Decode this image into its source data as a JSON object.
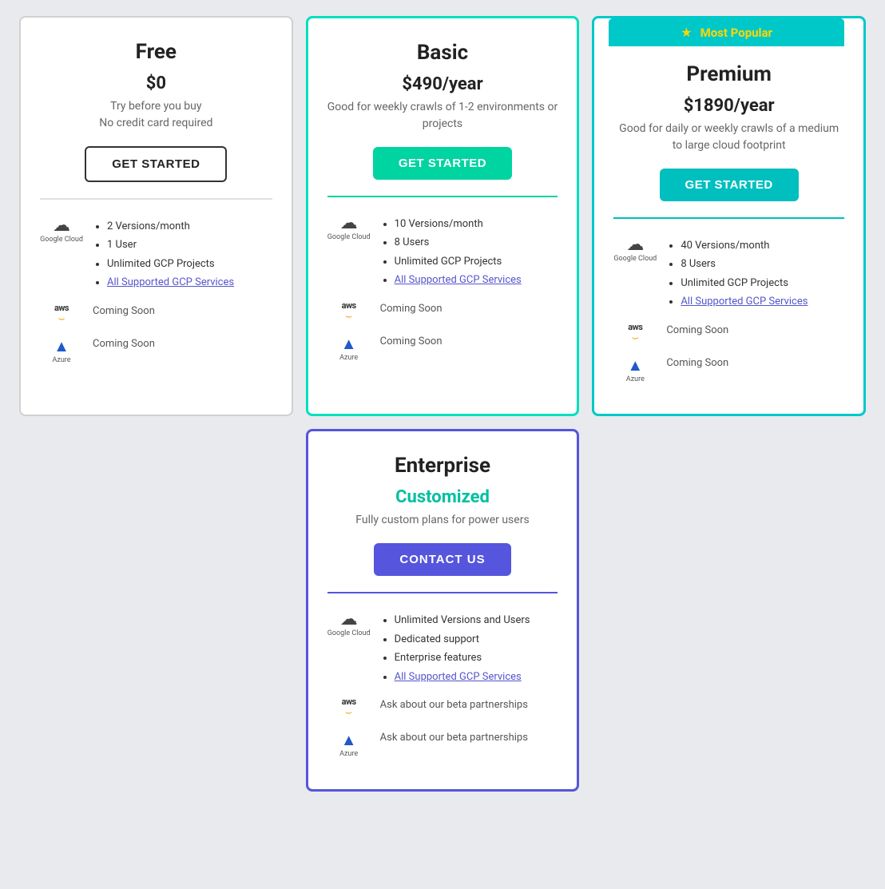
{
  "plans": {
    "free": {
      "title": "Free",
      "price": "$0",
      "desc": "Try before you buy\nNo credit card required",
      "btn_label": "GET STARTED",
      "features_gcp": [
        "2 Versions/month",
        "1 User",
        "Unlimited GCP Projects",
        "All Supported GCP Services"
      ],
      "aws_text": "Coming Soon",
      "azure_text": "Coming Soon"
    },
    "basic": {
      "title": "Basic",
      "price": "$490/year",
      "desc": "Good for weekly crawls of 1-2 environments or projects",
      "btn_label": "GET STARTED",
      "features_gcp": [
        "10 Versions/month",
        "8 Users",
        "Unlimited GCP Projects",
        "All Supported GCP Services"
      ],
      "aws_text": "Coming Soon",
      "azure_text": "Coming Soon"
    },
    "premium": {
      "title": "Premium",
      "price": "$1890/year",
      "desc": "Good for daily or weekly crawls of a medium to large cloud footprint",
      "btn_label": "GET STARTED",
      "most_popular": "Most Popular",
      "features_gcp": [
        "40 Versions/month",
        "8 Users",
        "Unlimited GCP Projects",
        "All Supported GCP Services"
      ],
      "aws_text": "Coming Soon",
      "azure_text": "Coming Soon"
    },
    "enterprise": {
      "title": "Enterprise",
      "price": "Customized",
      "desc": "Fully custom plans for power users",
      "btn_label": "CONTACT US",
      "features_gcp": [
        "Unlimited Versions and Users",
        "Dedicated support",
        "Enterprise features",
        "All Supported GCP Services"
      ],
      "aws_text": "Ask about our beta partnerships",
      "azure_text": "Ask about our beta partnerships"
    }
  },
  "icons": {
    "cloud": "☁",
    "gcp_label": "Google Cloud",
    "aws_label": "aws",
    "aws_smile": "⌣",
    "azure_label": "Azure",
    "azure_triangle": "▲",
    "star": "★"
  }
}
